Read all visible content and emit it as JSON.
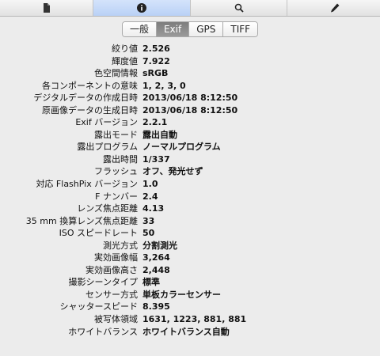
{
  "toolbar": {
    "buttons": [
      {
        "icon": "document-icon"
      },
      {
        "icon": "info-icon"
      },
      {
        "icon": "search-icon"
      },
      {
        "icon": "pen-icon"
      }
    ]
  },
  "tabs": [
    "一般",
    "Exif",
    "GPS",
    "TIFF"
  ],
  "selected_tab": "Exif",
  "rows": [
    {
      "label": "絞り値",
      "value": "2.526"
    },
    {
      "label": "輝度値",
      "value": "7.922"
    },
    {
      "label": "色空間情報",
      "value": "sRGB"
    },
    {
      "label": "各コンポーネントの意味",
      "value": "1, 2, 3, 0"
    },
    {
      "label": "デジタルデータの作成日時",
      "value": "2013/06/18 8:12:50"
    },
    {
      "label": "原画像データの生成日時",
      "value": "2013/06/18 8:12:50"
    },
    {
      "label": "Exif バージョン",
      "value": "2.2.1"
    },
    {
      "label": "露出モード",
      "value": "露出自動"
    },
    {
      "label": "露出プログラム",
      "value": "ノーマルプログラム"
    },
    {
      "label": "露出時間",
      "value": "1/337"
    },
    {
      "label": "フラッシュ",
      "value": "オフ、発光せず"
    },
    {
      "label": "対応 FlashPix バージョン",
      "value": "1.0"
    },
    {
      "label": "F ナンバー",
      "value": "2.4"
    },
    {
      "label": "レンズ焦点距離",
      "value": "4.13"
    },
    {
      "label": "35 mm 換算レンズ焦点距離",
      "value": "33"
    },
    {
      "label": "ISO スピードレート",
      "value": "50"
    },
    {
      "label": "測光方式",
      "value": "分割測光"
    },
    {
      "label": "実効画像幅",
      "value": "3,264"
    },
    {
      "label": "実効画像高さ",
      "value": "2,448"
    },
    {
      "label": "撮影シーンタイプ",
      "value": "標準"
    },
    {
      "label": "センサー方式",
      "value": "単板カラーセンサー"
    },
    {
      "label": "シャッタースピード",
      "value": "8.395"
    },
    {
      "label": "被写体領域",
      "value": "1631, 1223, 881, 881"
    },
    {
      "label": "ホワイトバランス",
      "value": "ホワイトバランス自動"
    }
  ]
}
